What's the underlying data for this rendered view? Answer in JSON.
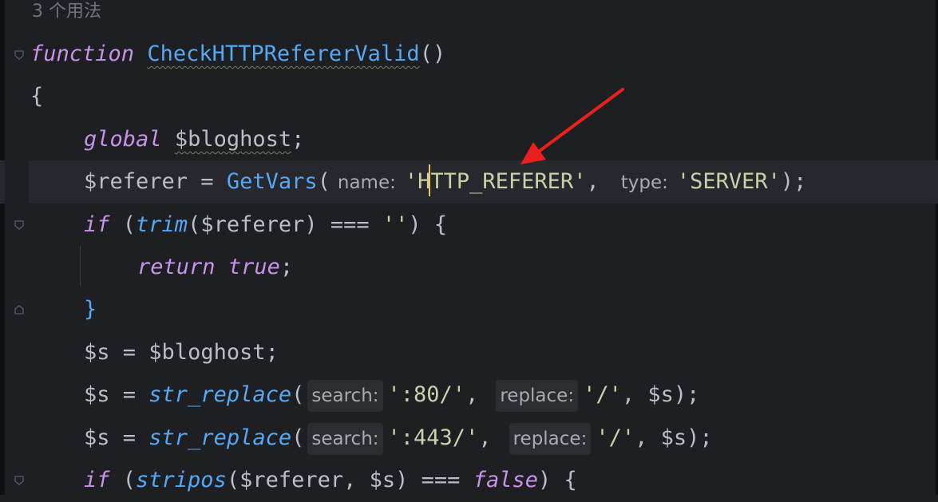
{
  "usages": "3 个用法",
  "code": {
    "l1": {
      "kw": "function",
      "name": "CheckHTTPRefererValid",
      "rest": "()"
    },
    "l2": "{",
    "l3": {
      "kw": "global",
      "var": "$bloghost",
      "end": ";"
    },
    "l4": {
      "var": "$referer",
      "op": " = ",
      "fn": "GetVars",
      "open": "(",
      "hint1": "name:",
      "arg1": "'HTTP_REFERER'",
      "sep": ",",
      "hint2": "type:",
      "arg2": "'SERVER'",
      "close": ");"
    },
    "l5": {
      "kw": "if",
      "a": " (",
      "fn": "trim",
      "b": "($referer)",
      "op": " === ",
      "str": "''",
      "c": ") {"
    },
    "l6": {
      "kw": "return",
      "val": "true",
      "end": ";"
    },
    "l7": "}",
    "l8": {
      "var": "$s",
      "op": " = ",
      "val": "$bloghost;"
    },
    "l9": {
      "var": "$s",
      "op": " = ",
      "fn": "str_replace",
      "open": "(",
      "hint1": "search:",
      "arg1": "':80/'",
      "sep": ",",
      "hint2": "replace:",
      "arg2": "'/'",
      "rest": ", $s);"
    },
    "l10": {
      "var": "$s",
      "op": " = ",
      "fn": "str_replace",
      "open": "(",
      "hint1": "search:",
      "arg1": "':443/'",
      "sep": ",",
      "hint2": "replace:",
      "arg2": "'/'",
      "rest": ", $s);"
    },
    "l11": {
      "kw": "if",
      "a": " (",
      "fn": "stripos",
      "b": "($referer, $s)",
      "op": " === ",
      "val": "false",
      "c": ") {"
    }
  },
  "colors": {
    "accent_arrow": "#e8211c",
    "caret": "#e8c45a",
    "background": "#1e1f22"
  }
}
